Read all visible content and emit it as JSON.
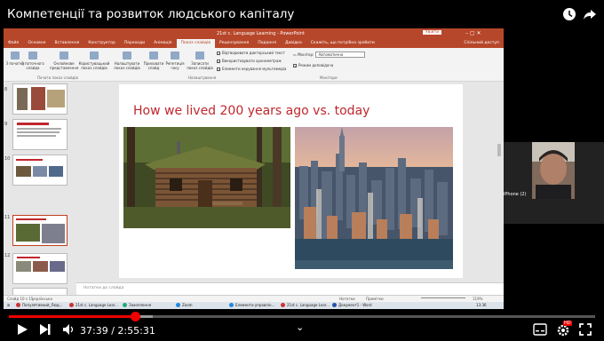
{
  "video": {
    "title": "Компетенції та розвиток людського капіталу",
    "current_time": "37:39",
    "duration": "2:55:31",
    "time_separator": " / ",
    "progress": 0.2144
  },
  "ppt": {
    "window_title": "21st c. Language Learning  -  PowerPoint",
    "signin": "Увійти",
    "share": "Спільний доступ",
    "tabs": [
      "Файл",
      "Основне",
      "Вставлення",
      "Конструктор",
      "Переходи",
      "Анімація",
      "Показ слайдів",
      "Рецензування",
      "Подання",
      "Довідка",
      "Скажіть, що потрібно зробити"
    ],
    "active_tab_index": 6,
    "ribbon": {
      "btn_start": "З початку",
      "btn_current": "З поточного слайда",
      "btn_online": "Онлайнове представлення",
      "btn_custom": "Користувацький показ слайдів",
      "btn_setup": "Налаштувати показ слайдів",
      "btn_hide": "Приховати слайд",
      "btn_rehearse": "Репетиція часу",
      "btn_record": "Записати показ слайдів",
      "chk_narrations": "Відтворювати дикторський текст",
      "chk_timings": "Використовувати хронометраж",
      "chk_media": "Елементи керування мультимедіа",
      "monitor_label": "Монітор:",
      "monitor_value": "Автоматично",
      "chk_presenter": "Режим доповідача",
      "group_start": "Почати показ слайдів",
      "group_setup": "Налаштування",
      "group_monitors": "Монітори"
    },
    "slide_numbers": [
      "8",
      "9",
      "10",
      "11",
      "12"
    ],
    "slide_title": "How we lived 200 years ago vs. today",
    "notes_placeholder": "Нотатки до слайда",
    "status_left": "Слайд 10 з 15",
    "status_lang": "українська",
    "status_notes": "Нотатки",
    "status_comments": "Примітки",
    "status_zoom": "119%",
    "taskbar": [
      "Популятивний_Люд...",
      "21st c. Language Lear...",
      "Захоплення",
      "Zoom",
      "Елементи управлін...",
      "21st c. Language Lear...",
      "Документ1 - Word"
    ],
    "clock": "13:36"
  },
  "webcam": {
    "label": "iPhone (2)"
  },
  "colors": {
    "ppt_accent": "#b7472a",
    "progress": "#ff0000"
  },
  "icons": [
    "clock-icon",
    "share-icon",
    "play-icon",
    "next-icon",
    "volume-icon",
    "chevron-down-icon",
    "subtitles-icon",
    "settings-icon",
    "fullscreen-icon"
  ]
}
